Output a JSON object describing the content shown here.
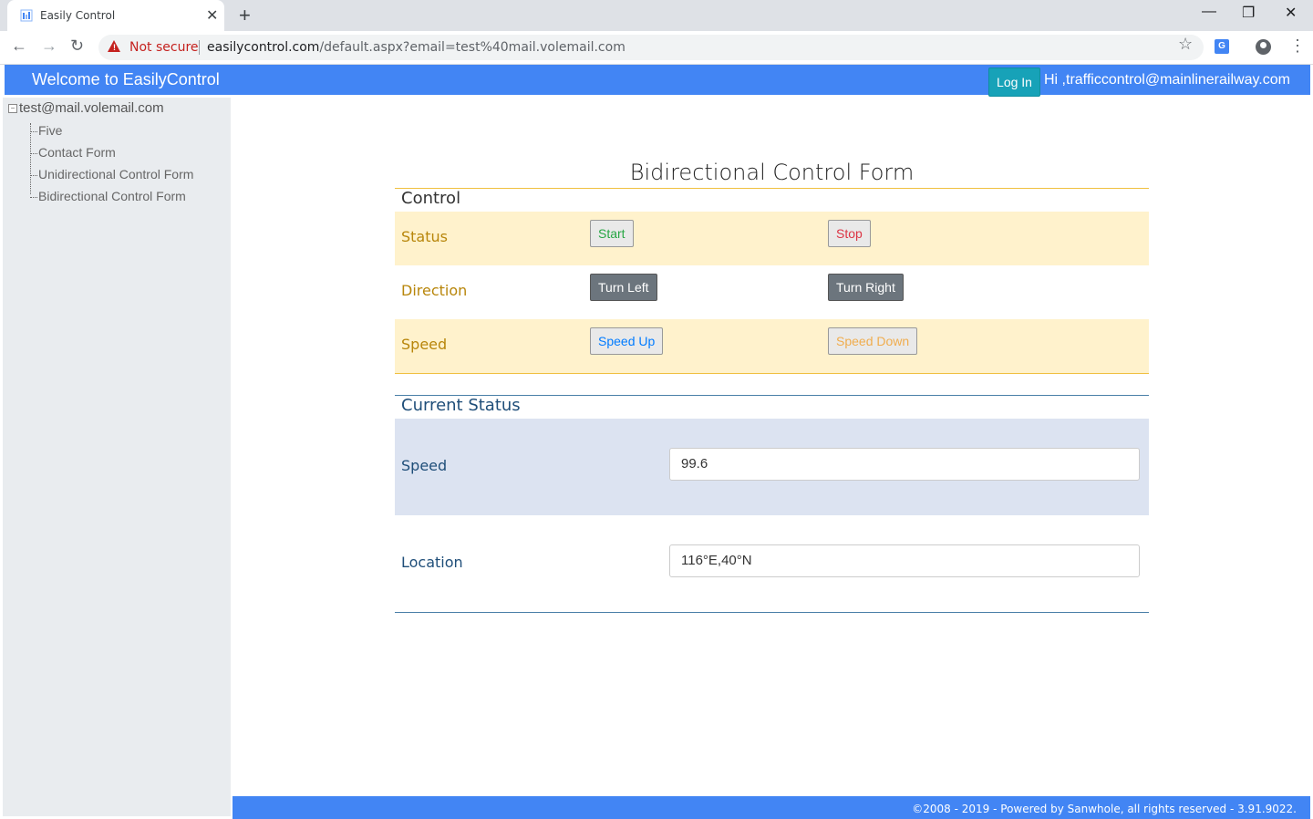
{
  "browser": {
    "tab_title": "Easily Control",
    "tab_close": "✕",
    "new_tab": "+",
    "minimize": "—",
    "restore": "❐",
    "close": "✕",
    "back": "←",
    "forward": "→",
    "reload": "↻",
    "security_label": "Not secure",
    "url_host": "easilycontrol.com",
    "url_path": "/default.aspx?email=test%40mail.volemail.com",
    "star": "☆",
    "translate": "G",
    "menu": "⋮"
  },
  "header": {
    "title": "Welcome to EasilyControl",
    "login_label": "Log In",
    "greeting": "Hi ,trafficcontrol@mainlinerailway.com"
  },
  "sidebar": {
    "root_toggle": "−",
    "root_label": "test@mail.volemail.com",
    "items": [
      {
        "label": "Five"
      },
      {
        "label": "Contact Form"
      },
      {
        "label": "Unidirectional Control Form"
      },
      {
        "label": "Bidirectional Control Form"
      }
    ]
  },
  "form": {
    "title": "Bidirectional Control Form",
    "control_section": "Control",
    "rows": [
      {
        "label": "Status",
        "btn1": "Start",
        "btn2": "Stop"
      },
      {
        "label": "Direction",
        "btn1": "Turn Left",
        "btn2": "Turn Right"
      },
      {
        "label": "Speed",
        "btn1": "Speed Up",
        "btn2": "Speed Down"
      }
    ],
    "status_section": "Current Status",
    "status": {
      "speed_label": "Speed",
      "speed_value": "99.6",
      "location_label": "Location",
      "location_value": "116°E,40°N"
    }
  },
  "footer": {
    "text": "©2008 - 2019 - Powered by Sanwhole, all rights reserved - 3.91.9022."
  },
  "colors": {
    "header_bg": "#4285f4",
    "login_bg": "#17a2b8",
    "start": "#28a745",
    "stop": "#dc3545",
    "speed_up": "#007bff",
    "speed_down": "#f0ad4e",
    "control_label": "#b8860b",
    "status_label": "#1f4e79"
  }
}
